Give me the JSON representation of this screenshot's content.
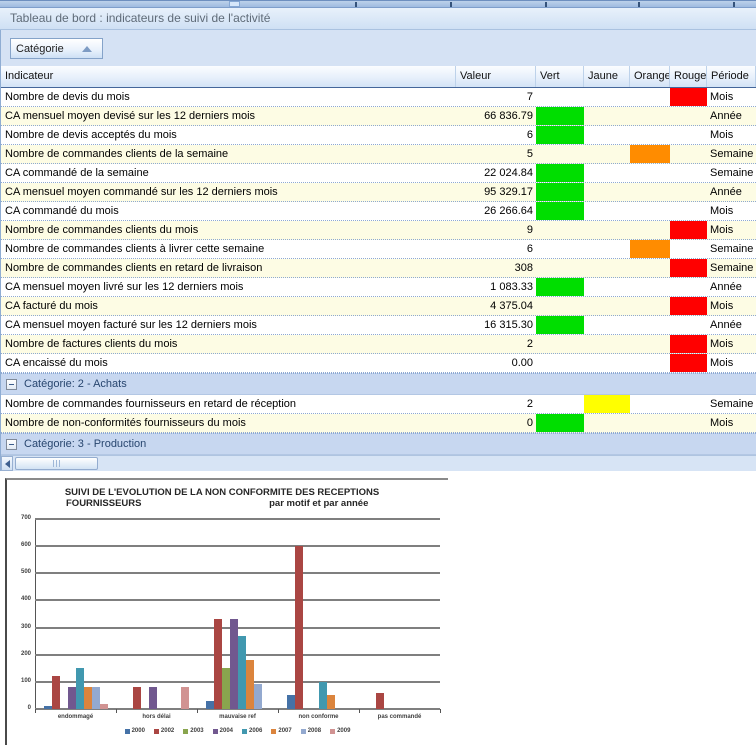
{
  "header": {
    "title": "Tableau de bord : indicateurs de suivi de l'activité"
  },
  "group_panel": {
    "button_label": "Catégorie"
  },
  "icons": {
    "category_sort": "up-triangle-sort-ascending",
    "group_collapse": "minus-box",
    "scrollbar_left": "left-arrow"
  },
  "table": {
    "columns": [
      "Indicateur",
      "Valeur",
      "Vert",
      "Jaune",
      "Orange",
      "Rouge",
      "Période"
    ],
    "status_colors": {
      "vert": "#00DE00",
      "jaune": "#FFFF00",
      "orange": "#FF8C00",
      "rouge": "#FF0000"
    },
    "body": [
      {
        "group": null,
        "rows": [
          {
            "label": "Nombre de devis du mois",
            "value": "7",
            "status": "rouge",
            "periode": "Mois"
          },
          {
            "label": "CA mensuel moyen devisé sur les 12 derniers mois",
            "value": "66 836.79",
            "status": "vert",
            "periode": "Année"
          },
          {
            "label": "Nombre de devis acceptés du mois",
            "value": "6",
            "status": "vert",
            "periode": "Mois"
          },
          {
            "label": "Nombre de commandes clients de la semaine",
            "value": "5",
            "status": "orange",
            "periode": "Semaine"
          },
          {
            "label": "CA commandé de la semaine",
            "value": "22 024.84",
            "status": "vert",
            "periode": "Semaine"
          },
          {
            "label": "CA mensuel moyen commandé sur les 12 derniers mois",
            "value": "95 329.17",
            "status": "vert",
            "periode": "Année"
          },
          {
            "label": "CA commandé du mois",
            "value": "26 266.64",
            "status": "vert",
            "periode": "Mois"
          },
          {
            "label": "Nombre de commandes clients du mois",
            "value": "9",
            "status": "rouge",
            "periode": "Mois"
          },
          {
            "label": "Nombre de commandes clients à livrer cette semaine",
            "value": "6",
            "status": "orange",
            "periode": "Semaine"
          },
          {
            "label": "Nombre de commandes clients en retard de livraison",
            "value": "308",
            "status": "rouge",
            "periode": "Semaine"
          },
          {
            "label": "CA mensuel moyen livré sur les 12 derniers mois",
            "value": "1 083.33",
            "status": "vert",
            "periode": "Année"
          },
          {
            "label": "CA facturé du mois",
            "value": "4 375.04",
            "status": "rouge",
            "periode": "Mois"
          },
          {
            "label": "CA mensuel moyen facturé sur les 12 derniers mois",
            "value": "16 315.30",
            "status": "vert",
            "periode": "Année"
          },
          {
            "label": "Nombre de factures clients du mois",
            "value": "2",
            "status": "rouge",
            "periode": "Mois"
          },
          {
            "label": "CA encaissé du mois",
            "value": "0.00",
            "status": "rouge",
            "periode": "Mois"
          }
        ]
      },
      {
        "group": "Catégorie: 2 - Achats",
        "rows": [
          {
            "label": "Nombre de commandes fournisseurs en retard de réception",
            "value": "2",
            "status": "jaune",
            "periode": "Semaine"
          },
          {
            "label": "Nombre de non-conformités fournisseurs du mois",
            "value": "0",
            "status": "vert",
            "periode": "Mois"
          }
        ]
      },
      {
        "group": "Catégorie: 3 - Production",
        "rows": []
      }
    ]
  },
  "chart_data": {
    "type": "bar",
    "title": "SUIVI DE L'EVOLUTION DE LA NON CONFORMITE DES RECEPTIONS FOURNISSEURS",
    "subtitle": "par motif et par année",
    "title_lines": {
      "line1": "SUIVI DE L'EVOLUTION DE LA NON CONFORMITE DES RECEPTIONS",
      "line2_left": "FOURNISSEURS",
      "line2_right": "par motif et par année"
    },
    "categories": [
      "endommagé",
      "hors délai",
      "mauvaise ref",
      "non conforme",
      "pas commandé"
    ],
    "series": [
      {
        "name": "2000",
        "color": "#4572A7",
        "values": [
          12,
          0,
          30,
          53,
          0
        ]
      },
      {
        "name": "2002",
        "color": "#AA4643",
        "values": [
          122,
          82,
          330,
          600,
          60
        ]
      },
      {
        "name": "2003",
        "color": "#89A54E",
        "values": [
          0,
          0,
          150,
          0,
          0
        ]
      },
      {
        "name": "2004",
        "color": "#71588F",
        "values": [
          82,
          82,
          330,
          0,
          0
        ]
      },
      {
        "name": "2006",
        "color": "#4198AF",
        "values": [
          150,
          0,
          270,
          100,
          0
        ]
      },
      {
        "name": "2007",
        "color": "#DB843D",
        "values": [
          82,
          0,
          180,
          53,
          0
        ]
      },
      {
        "name": "2008",
        "color": "#93A9CF",
        "values": [
          82,
          0,
          93,
          0,
          0
        ]
      },
      {
        "name": "2009",
        "color": "#D19392",
        "values": [
          20,
          82,
          0,
          0,
          0
        ]
      }
    ],
    "ylim": [
      0,
      700
    ],
    "yticks": [
      0,
      100,
      200,
      300,
      400,
      500,
      600,
      700
    ],
    "grid": true,
    "legend_position": "bottom"
  }
}
